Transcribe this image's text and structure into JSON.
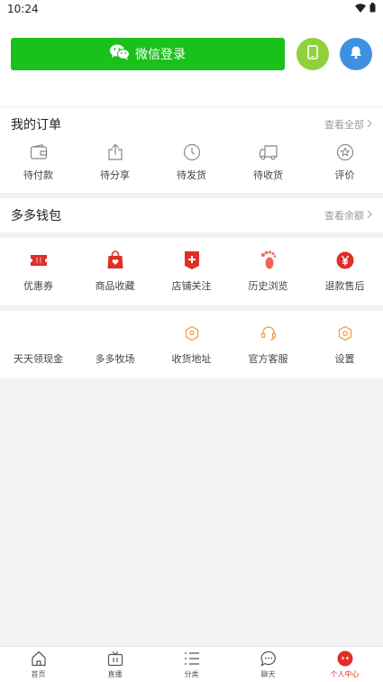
{
  "status": {
    "time": "10:24"
  },
  "login": {
    "wechat_label": "微信登录"
  },
  "orders": {
    "title": "我的订单",
    "view_all": "查看全部",
    "items": [
      {
        "label": "待付款",
        "icon": "wallet-icon"
      },
      {
        "label": "待分享",
        "icon": "share-icon"
      },
      {
        "label": "待发货",
        "icon": "clock-icon"
      },
      {
        "label": "待收货",
        "icon": "truck-icon"
      },
      {
        "label": "评价",
        "icon": "review-icon"
      }
    ]
  },
  "wallet": {
    "title": "多多钱包",
    "view_balance": "查看余额"
  },
  "favorites": {
    "items": [
      {
        "label": "优惠券",
        "icon": "coupon-icon"
      },
      {
        "label": "商品收藏",
        "icon": "bag-heart-icon"
      },
      {
        "label": "店铺关注",
        "icon": "shop-plus-icon"
      },
      {
        "label": "历史浏览",
        "icon": "footprint-icon"
      },
      {
        "label": "退款售后",
        "icon": "yen-icon"
      }
    ]
  },
  "tools": {
    "items": [
      {
        "label": "天天领现金",
        "icon": ""
      },
      {
        "label": "多多牧场",
        "icon": ""
      },
      {
        "label": "收货地址",
        "icon": "location-icon"
      },
      {
        "label": "官方客服",
        "icon": "headset-icon"
      },
      {
        "label": "设置",
        "icon": "settings-icon"
      }
    ]
  },
  "tabs": [
    {
      "label": "首页",
      "icon": "home-icon"
    },
    {
      "label": "直播",
      "icon": "tv-icon"
    },
    {
      "label": "分类",
      "icon": "list-icon"
    },
    {
      "label": "聊天",
      "icon": "chat-icon"
    },
    {
      "label": "个人中心",
      "icon": "profile-icon",
      "active": true
    }
  ],
  "colors": {
    "wechat_green": "#1ac11a",
    "accent_red": "#e02e24",
    "phone_green": "#8fd13a",
    "bell_blue": "#3d91e0",
    "orange": "#f39a3c"
  }
}
